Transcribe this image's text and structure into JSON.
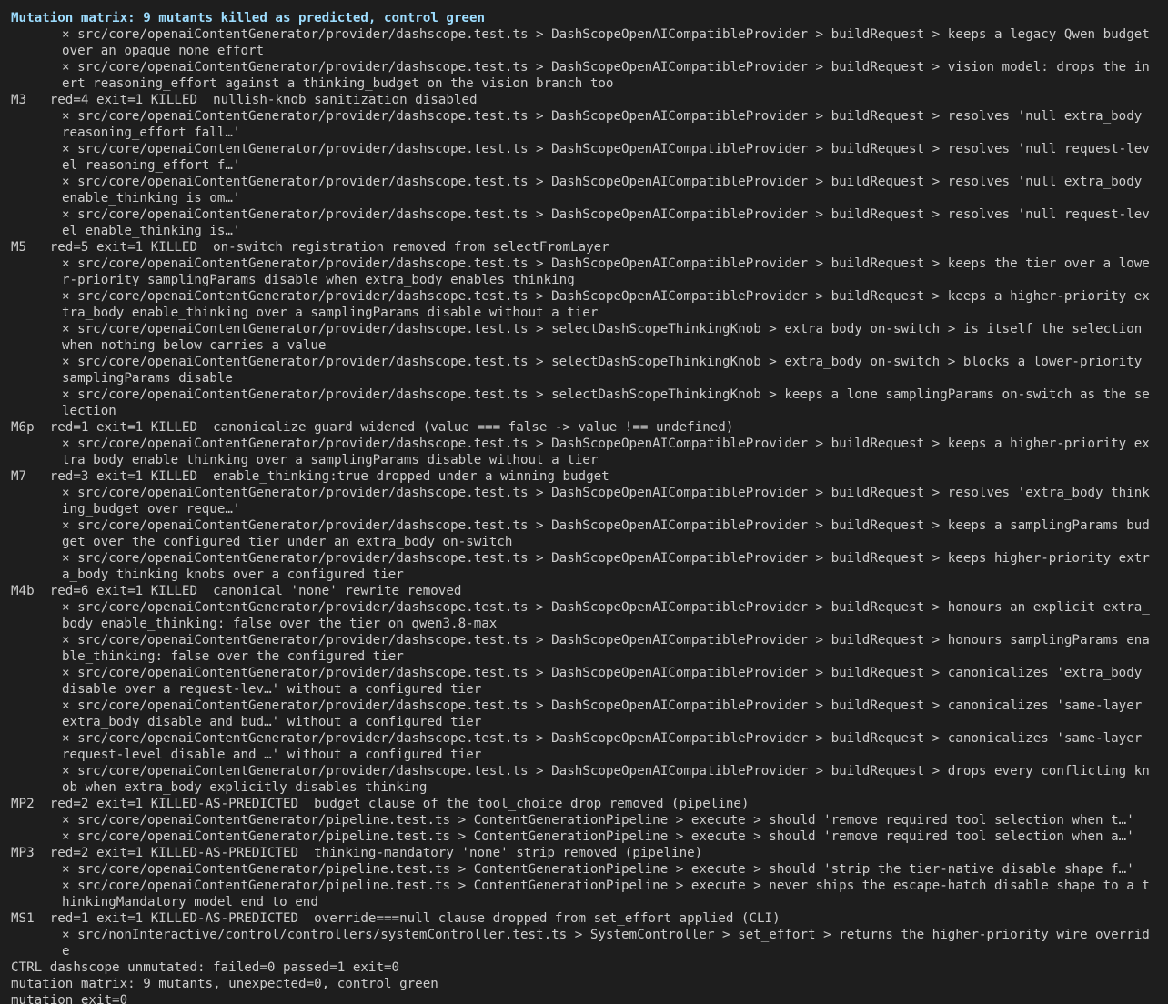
{
  "terminal": {
    "lines": [
      {
        "kind": "heading",
        "text": "Mutation matrix: 9 mutants killed as predicted, control green"
      },
      {
        "kind": "fail",
        "text": "× src/core/openaiContentGenerator/provider/dashscope.test.ts > DashScopeOpenAICompatibleProvider > buildRequest > keeps a legacy Qwen budget over an opaque none effort"
      },
      {
        "kind": "fail",
        "text": "× src/core/openaiContentGenerator/provider/dashscope.test.ts > DashScopeOpenAICompatibleProvider > buildRequest > vision model: drops the inert reasoning_effort against a thinking_budget on the vision branch too"
      },
      {
        "kind": "mutant",
        "text": "M3   red=4 exit=1 KILLED  nullish-knob sanitization disabled"
      },
      {
        "kind": "fail",
        "text": "× src/core/openaiContentGenerator/provider/dashscope.test.ts > DashScopeOpenAICompatibleProvider > buildRequest > resolves 'null extra_body reasoning_effort fall…'"
      },
      {
        "kind": "fail",
        "text": "× src/core/openaiContentGenerator/provider/dashscope.test.ts > DashScopeOpenAICompatibleProvider > buildRequest > resolves 'null request-level reasoning_effort f…'"
      },
      {
        "kind": "fail",
        "text": "× src/core/openaiContentGenerator/provider/dashscope.test.ts > DashScopeOpenAICompatibleProvider > buildRequest > resolves 'null extra_body enable_thinking is om…'"
      },
      {
        "kind": "fail",
        "text": "× src/core/openaiContentGenerator/provider/dashscope.test.ts > DashScopeOpenAICompatibleProvider > buildRequest > resolves 'null request-level enable_thinking is…'"
      },
      {
        "kind": "mutant",
        "text": "M5   red=5 exit=1 KILLED  on-switch registration removed from selectFromLayer"
      },
      {
        "kind": "fail",
        "text": "× src/core/openaiContentGenerator/provider/dashscope.test.ts > DashScopeOpenAICompatibleProvider > buildRequest > keeps the tier over a lower-priority samplingParams disable when extra_body enables thinking"
      },
      {
        "kind": "fail",
        "text": "× src/core/openaiContentGenerator/provider/dashscope.test.ts > DashScopeOpenAICompatibleProvider > buildRequest > keeps a higher-priority extra_body enable_thinking over a samplingParams disable without a tier"
      },
      {
        "kind": "fail",
        "text": "× src/core/openaiContentGenerator/provider/dashscope.test.ts > selectDashScopeThinkingKnob > extra_body on-switch > is itself the selection when nothing below carries a value"
      },
      {
        "kind": "fail",
        "text": "× src/core/openaiContentGenerator/provider/dashscope.test.ts > selectDashScopeThinkingKnob > extra_body on-switch > blocks a lower-priority samplingParams disable"
      },
      {
        "kind": "fail",
        "text": "× src/core/openaiContentGenerator/provider/dashscope.test.ts > selectDashScopeThinkingKnob > keeps a lone samplingParams on-switch as the selection"
      },
      {
        "kind": "mutant",
        "text": "M6p  red=1 exit=1 KILLED  canonicalize guard widened (value === false -> value !== undefined)"
      },
      {
        "kind": "fail",
        "text": "× src/core/openaiContentGenerator/provider/dashscope.test.ts > DashScopeOpenAICompatibleProvider > buildRequest > keeps a higher-priority extra_body enable_thinking over a samplingParams disable without a tier"
      },
      {
        "kind": "mutant",
        "text": "M7   red=3 exit=1 KILLED  enable_thinking:true dropped under a winning budget"
      },
      {
        "kind": "fail",
        "text": "× src/core/openaiContentGenerator/provider/dashscope.test.ts > DashScopeOpenAICompatibleProvider > buildRequest > resolves 'extra_body thinking_budget over reque…'"
      },
      {
        "kind": "fail",
        "text": "× src/core/openaiContentGenerator/provider/dashscope.test.ts > DashScopeOpenAICompatibleProvider > buildRequest > keeps a samplingParams budget over the configured tier under an extra_body on-switch"
      },
      {
        "kind": "fail",
        "text": "× src/core/openaiContentGenerator/provider/dashscope.test.ts > DashScopeOpenAICompatibleProvider > buildRequest > keeps higher-priority extra_body thinking knobs over a configured tier"
      },
      {
        "kind": "mutant",
        "text": "M4b  red=6 exit=1 KILLED  canonical 'none' rewrite removed"
      },
      {
        "kind": "fail",
        "text": "× src/core/openaiContentGenerator/provider/dashscope.test.ts > DashScopeOpenAICompatibleProvider > buildRequest > honours an explicit extra_body enable_thinking: false over the tier on qwen3.8-max"
      },
      {
        "kind": "fail",
        "text": "× src/core/openaiContentGenerator/provider/dashscope.test.ts > DashScopeOpenAICompatibleProvider > buildRequest > honours samplingParams enable_thinking: false over the configured tier"
      },
      {
        "kind": "fail",
        "text": "× src/core/openaiContentGenerator/provider/dashscope.test.ts > DashScopeOpenAICompatibleProvider > buildRequest > canonicalizes 'extra_body disable over a request-lev…' without a configured tier"
      },
      {
        "kind": "fail",
        "text": "× src/core/openaiContentGenerator/provider/dashscope.test.ts > DashScopeOpenAICompatibleProvider > buildRequest > canonicalizes 'same-layer extra_body disable and bud…' without a configured tier"
      },
      {
        "kind": "fail",
        "text": "× src/core/openaiContentGenerator/provider/dashscope.test.ts > DashScopeOpenAICompatibleProvider > buildRequest > canonicalizes 'same-layer request-level disable and …' without a configured tier"
      },
      {
        "kind": "fail",
        "text": "× src/core/openaiContentGenerator/provider/dashscope.test.ts > DashScopeOpenAICompatibleProvider > buildRequest > drops every conflicting knob when extra_body explicitly disables thinking"
      },
      {
        "kind": "mutant",
        "text": "MP2  red=2 exit=1 KILLED-AS-PREDICTED  budget clause of the tool_choice drop removed (pipeline)"
      },
      {
        "kind": "fail",
        "text": "× src/core/openaiContentGenerator/pipeline.test.ts > ContentGenerationPipeline > execute > should 'remove required tool selection when t…'"
      },
      {
        "kind": "fail",
        "text": "× src/core/openaiContentGenerator/pipeline.test.ts > ContentGenerationPipeline > execute > should 'remove required tool selection when a…'"
      },
      {
        "kind": "mutant",
        "text": "MP3  red=2 exit=1 KILLED-AS-PREDICTED  thinking-mandatory 'none' strip removed (pipeline)"
      },
      {
        "kind": "fail",
        "text": "× src/core/openaiContentGenerator/pipeline.test.ts > ContentGenerationPipeline > execute > should 'strip the tier-native disable shape f…'"
      },
      {
        "kind": "fail",
        "text": "× src/core/openaiContentGenerator/pipeline.test.ts > ContentGenerationPipeline > execute > never ships the escape-hatch disable shape to a thinkingMandatory model end to end"
      },
      {
        "kind": "mutant",
        "text": "MS1  red=1 exit=1 KILLED-AS-PREDICTED  override===null clause dropped from set_effort applied (CLI)"
      },
      {
        "kind": "fail",
        "text": "× src/nonInteractive/control/controllers/systemController.test.ts > SystemController > set_effort > returns the higher-priority wire override"
      },
      {
        "kind": "summary",
        "text": "CTRL dashscope unmutated: failed=0 passed=1 exit=0"
      },
      {
        "kind": "summary",
        "text": "mutation matrix: 9 mutants, unexpected=0, control green"
      },
      {
        "kind": "summary",
        "text": "mutation exit=0"
      }
    ]
  },
  "colors": {
    "background": "#1e1e1e",
    "text": "#cccccc",
    "heading": "#9cdcfe"
  }
}
